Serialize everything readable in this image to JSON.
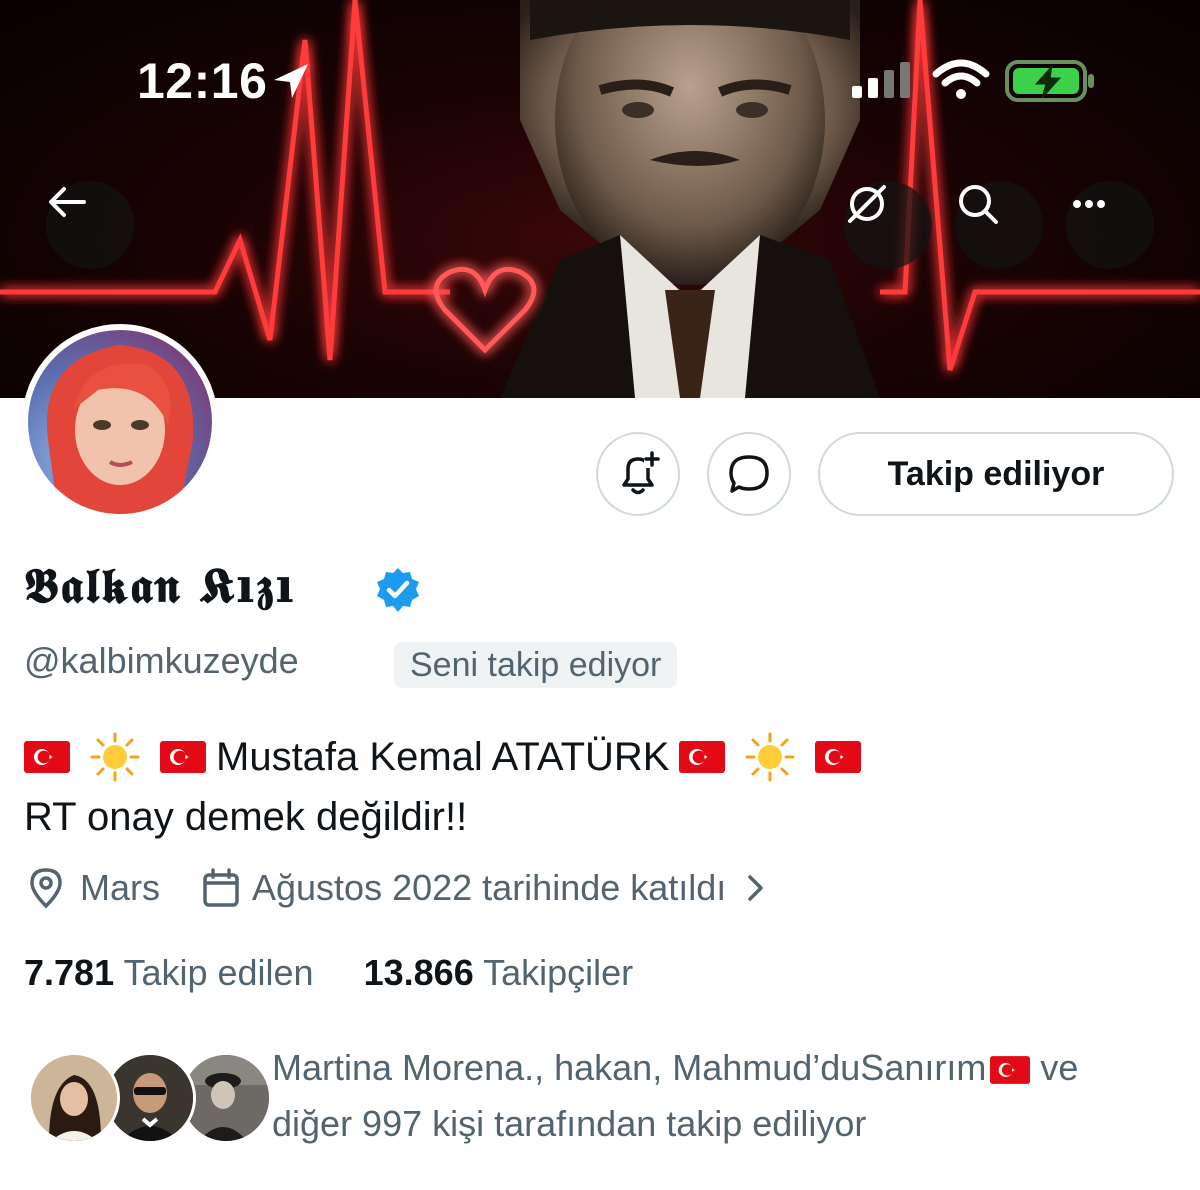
{
  "status_bar": {
    "time": "12:16",
    "icons": [
      "location-arrow-icon",
      "signal-icon",
      "wifi-icon",
      "battery-charging-icon"
    ]
  },
  "banner": {
    "nav": {
      "back_icon": "arrow-left-icon",
      "actions": [
        "no-notifications-icon",
        "search-icon",
        "more-icon"
      ]
    }
  },
  "profile": {
    "display_name": "𝕭𝖆𝖑𝖐𝖆𝖓 𝕶ı𝖟ı",
    "verified_icon": "verified-badge-icon",
    "handle": "@kalbimkuzeyde",
    "follows_you_badge": "Seni takip ediyor",
    "bio": {
      "line1_text": "Mustafa Kemal ATATÜRK",
      "line2": "RT onay demek değildir!!"
    },
    "location": "Mars",
    "joined": "Ağustos 2022 tarihinde katıldı",
    "following_count": "7.781",
    "following_label": "Takip edilen",
    "followers_count": "13.866",
    "followers_label": "Takipçiler"
  },
  "actions": {
    "notify_icon": "bell-plus-icon",
    "message_icon": "chat-bubble-icon",
    "follow_button": "Takip ediliyor"
  },
  "mutuals": {
    "text_line1": "Martina Morena., hakan, Mahmud’duSanırım",
    "text_ve": " ve",
    "text_line2": "diğer 997 kişi tarafından takip ediliyor"
  },
  "colors": {
    "accent_verified": "#1d9bf0",
    "secondary_text": "#536471",
    "primary_text": "#0f1419",
    "border": "#cfd9de"
  }
}
